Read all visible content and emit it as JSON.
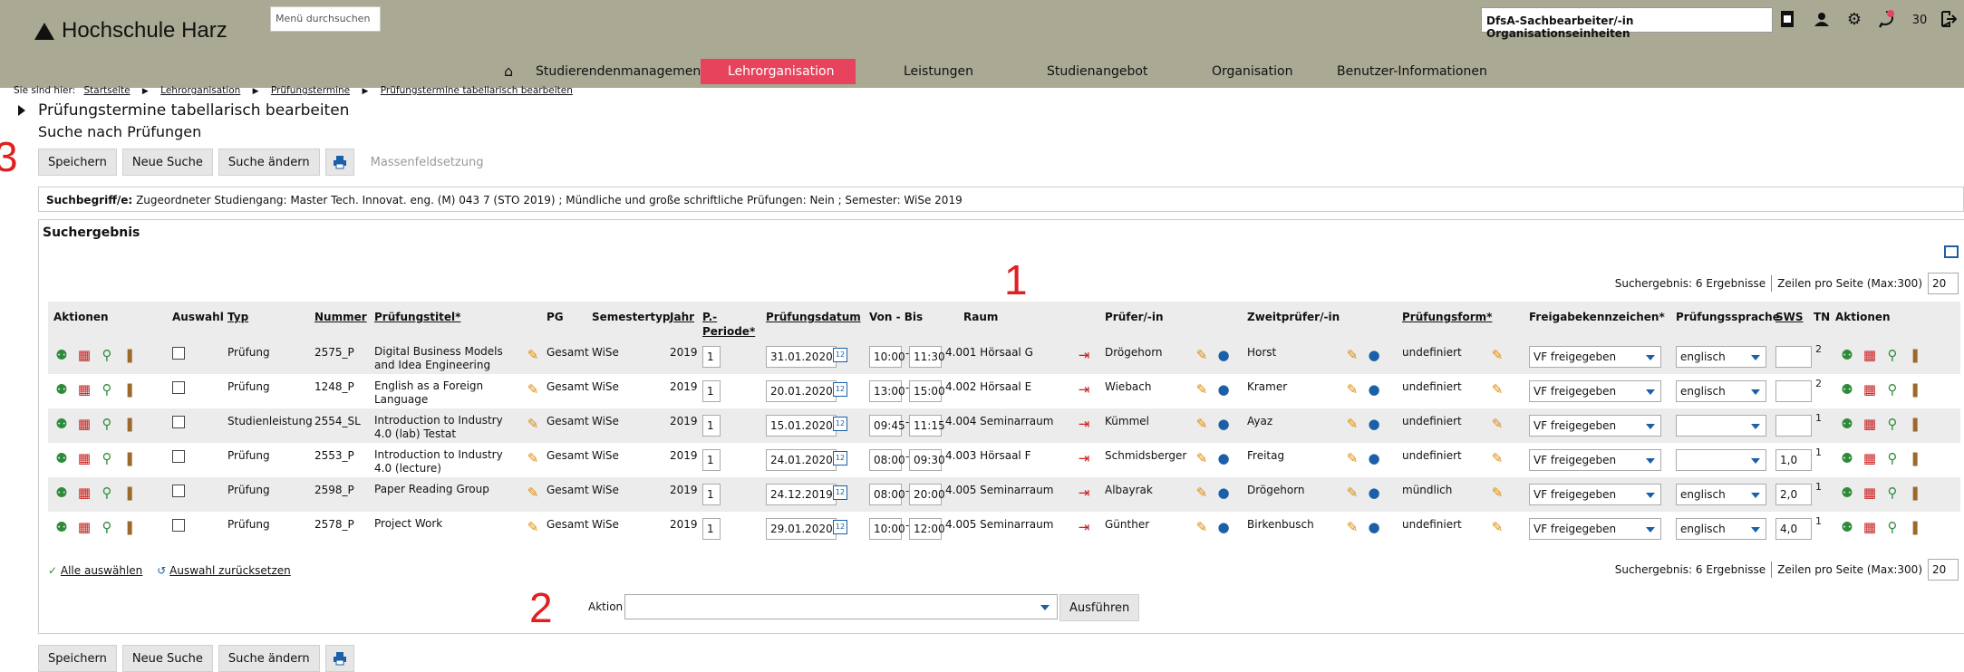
{
  "header": {
    "logo_text": "Hochschule Harz",
    "menu_search_placeholder": "Menü durchsuchen",
    "role": "DfsA-Sachbearbeiter/-in Organisationseinheiten",
    "notification_count": "30",
    "icons": [
      "doc-icon",
      "user-icon",
      "gear-icon",
      "chat-icon",
      "logout-icon"
    ]
  },
  "nav": {
    "home_icon": "home-icon",
    "items": [
      "Studierendenmanagement",
      "Lehrorganisation",
      "Leistungen",
      "Studienangebot",
      "Organisation",
      "Benutzer-Informationen"
    ],
    "active": "Lehrorganisation",
    "active_color": "#e8435c",
    "header_color": "#aaa994"
  },
  "breadcrumb": {
    "prefix": "Sie sind hier:",
    "items": [
      "Startseite",
      "Lehrorganisation",
      "Prüfungstermine",
      "Prüfungstermine tabellarisch bearbeiten"
    ]
  },
  "page": {
    "title": "Prüfungstermine tabellarisch bearbeiten",
    "subtitle": "Suche nach Prüfungen"
  },
  "annotations": {
    "a1": "1",
    "a2": "2",
    "a3": "3"
  },
  "toolbar": {
    "save": "Speichern",
    "new_search": "Neue Suche",
    "change_search": "Suche ändern",
    "print_icon": "printer-icon",
    "mass_edit": "Massenfeldsetzung"
  },
  "criteria": {
    "label": "Suchbegriff/e:",
    "text": "Zugeordneter Studiengang: Master Tech. Innovat. eng. (M) 043 7 (STO 2019) ;  Mündliche und große schriftliche Prüfungen: Nein ;  Semester: WiSe 2019"
  },
  "results": {
    "title": "Suchergebnis",
    "count_text": "Suchergebnis: 6 Ergebnisse",
    "rows_label": "Zeilen pro Seite (Max:300)",
    "rows_value": "20",
    "columns": {
      "aktionen": "Aktionen",
      "auswahl": "Auswahl",
      "typ": "Typ",
      "nummer": "Nummer",
      "titel": "Prüfungstitel*",
      "pg": "PG",
      "semestertyp": "Semestertyp",
      "jahr": "Jahr",
      "periode": "P.-Periode*",
      "datum": "Prüfungsdatum",
      "vonbis": "Von - Bis",
      "raum": "Raum",
      "pruefer": "Prüfer/-in",
      "zweitpruefer": "Zweitprüfer/-in",
      "form": "Prüfungsform*",
      "freigabe": "Freigabekennzeichen*",
      "sprache": "Prüfungssprache",
      "sws": "SWS",
      "tn": "TN",
      "aktionen2": "Aktionen"
    },
    "rows": [
      {
        "typ": "Prüfung",
        "nummer": "2575_P",
        "titel": "Digital Business Models and Idea Engineering",
        "pg": "Gesamt",
        "semestertyp": "WiSe",
        "jahr": "2019",
        "periode": "1",
        "datum": "31.01.2020",
        "von": "10:00",
        "bis": "11:30",
        "raum": "4.001 Hörsaal G",
        "pruefer": "Drögehorn",
        "zweitpruefer": "Horst",
        "form": "undefiniert",
        "freigabe": "VF freigegeben",
        "sprache": "englisch",
        "sws": "",
        "tn": "2"
      },
      {
        "typ": "Prüfung",
        "nummer": "1248_P",
        "titel": "English as a Foreign Language",
        "pg": "Gesamt",
        "semestertyp": "WiSe",
        "jahr": "2019",
        "periode": "1",
        "datum": "20.01.2020",
        "von": "13:00",
        "bis": "15:00",
        "raum": "4.002 Hörsaal E",
        "pruefer": "Wiebach",
        "zweitpruefer": "Kramer",
        "form": "undefiniert",
        "freigabe": "VF freigegeben",
        "sprache": "englisch",
        "sws": "",
        "tn": "2"
      },
      {
        "typ": "Studienleistung",
        "nummer": "2554_SL",
        "titel": "Introduction to Industry 4.0 (lab) Testat",
        "pg": "Gesamt",
        "semestertyp": "WiSe",
        "jahr": "2019",
        "periode": "1",
        "datum": "15.01.2020",
        "von": "09:45",
        "bis": "11:15",
        "raum": "4.004 Seminarraum",
        "pruefer": "Kümmel",
        "zweitpruefer": "Ayaz",
        "form": "undefiniert",
        "freigabe": "VF freigegeben",
        "sprache": "",
        "sws": "",
        "tn": "1"
      },
      {
        "typ": "Prüfung",
        "nummer": "2553_P",
        "titel": "Introduction to Industry 4.0 (lecture)",
        "pg": "Gesamt",
        "semestertyp": "WiSe",
        "jahr": "2019",
        "periode": "1",
        "datum": "24.01.2020",
        "von": "08:00",
        "bis": "09:30",
        "raum": "4.003 Hörsaal F",
        "pruefer": "Schmidsberger",
        "zweitpruefer": "Freitag",
        "form": "undefiniert",
        "freigabe": "VF freigegeben",
        "sprache": "",
        "sws": "1,0",
        "tn": "1"
      },
      {
        "typ": "Prüfung",
        "nummer": "2598_P",
        "titel": "Paper Reading Group",
        "pg": "Gesamt",
        "semestertyp": "WiSe",
        "jahr": "2019",
        "periode": "1",
        "datum": "24.12.2019",
        "von": "08:00",
        "bis": "20:00",
        "raum": "4.005 Seminarraum",
        "pruefer": "Albayrak",
        "zweitpruefer": "Drögehorn",
        "form": "mündlich",
        "freigabe": "VF freigegeben",
        "sprache": "englisch",
        "sws": "2,0",
        "tn": "1"
      },
      {
        "typ": "Prüfung",
        "nummer": "2578_P",
        "titel": "Project Work",
        "pg": "Gesamt",
        "semestertyp": "WiSe",
        "jahr": "2019",
        "periode": "1",
        "datum": "29.01.2020",
        "von": "10:00",
        "bis": "12:00",
        "raum": "4.005 Seminarraum",
        "pruefer": "Günther",
        "zweitpruefer": "Birkenbusch",
        "form": "undefiniert",
        "freigabe": "VF freigegeben",
        "sprache": "englisch",
        "sws": "4,0",
        "tn": "1"
      }
    ],
    "select_all": "Alle auswählen",
    "reset_selection": "Auswahl zurücksetzen",
    "action_label": "Aktion",
    "run": "Ausführen"
  }
}
